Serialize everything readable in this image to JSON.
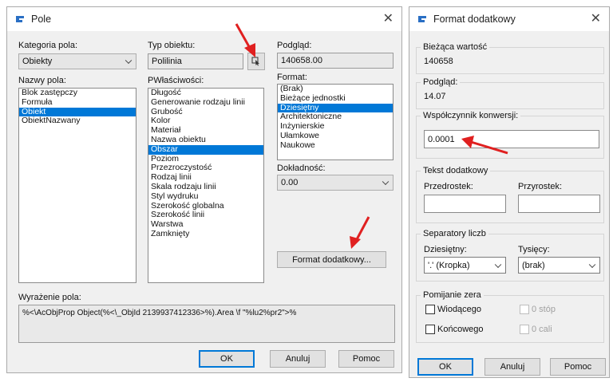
{
  "pole": {
    "title": "Pole",
    "kategoria_label": "Kategoria pola:",
    "kategoria_value": "Obiekty",
    "nazwy_label": "Nazwy pola:",
    "nazwy_items": [
      "Blok zastępczy",
      "Formuła",
      "Obiekt",
      "ObiektNazwany"
    ],
    "nazwy_selected": 2,
    "typ_label": "Typ obiektu:",
    "typ_value": "Polilinia",
    "wlasciwosci_label": "PWłaściwości:",
    "wlasciwosci_items": [
      "Długość",
      "Generowanie rodzaju linii",
      "Grubość",
      "Kolor",
      "Materiał",
      "Nazwa obiektu",
      "Obszar",
      "Poziom",
      "Przezroczystość",
      "Rodzaj linii",
      "Skala rodzaju linii",
      "Styl wydruku",
      "Szerokość globalna",
      "Szerokość linii",
      "Warstwa",
      "Zamknięty"
    ],
    "wlasciwosci_selected": 6,
    "podglad_label": "Podgląd:",
    "podglad_value": "140658.00",
    "format_label": "Format:",
    "format_items": [
      "(Brak)",
      "Bieżące jednostki",
      "Dziesiętny",
      "Architektoniczne",
      "Inżynierskie",
      "Ułamkowe",
      "Naukowe"
    ],
    "format_selected": 2,
    "dokladnosc_label": "Dokładność:",
    "dokladnosc_value": "0.00",
    "format_dodatkowy_button": "Format dodatkowy...",
    "wyrazenie_label": "Wyrażenie pola:",
    "wyrazenie_value": "%<\\AcObjProp Object(%<\\_ObjId 2139937412336>%).Area \\f \"%lu2%pr2\">%",
    "ok": "OK",
    "anuluj": "Anuluj",
    "pomoc": "Pomoc"
  },
  "format": {
    "title": "Format dodatkowy",
    "biezaca_label": "Bieżąca wartość",
    "biezaca_value": "140658",
    "podglad_label": "Podgląd:",
    "podglad_value": "14.07",
    "wspolczynnik_label": "Współczynnik konwersji:",
    "wspolczynnik_value": "0.0001",
    "tekst_group": "Tekst dodatkowy",
    "przedrostek_label": "Przedrostek:",
    "przyrostek_label": "Przyrostek:",
    "separatory_group": "Separatory liczb",
    "dziesietny_label": "Dziesiętny:",
    "dziesietny_value": "'.' (Kropka)",
    "tysiecy_label": "Tysięcy:",
    "tysiecy_value": "(brak)",
    "pomijanie_group": "Pomijanie zera",
    "wiodacego": "Wiodącego",
    "koncowego": "Końcowego",
    "stop": "0 stóp",
    "cali": "0 cali",
    "ok": "OK",
    "anuluj": "Anuluj",
    "pomoc": "Pomoc"
  },
  "colors": {
    "accent": "#0078d7",
    "arrow": "#e02020",
    "app_icon": "#2a6fc4"
  }
}
